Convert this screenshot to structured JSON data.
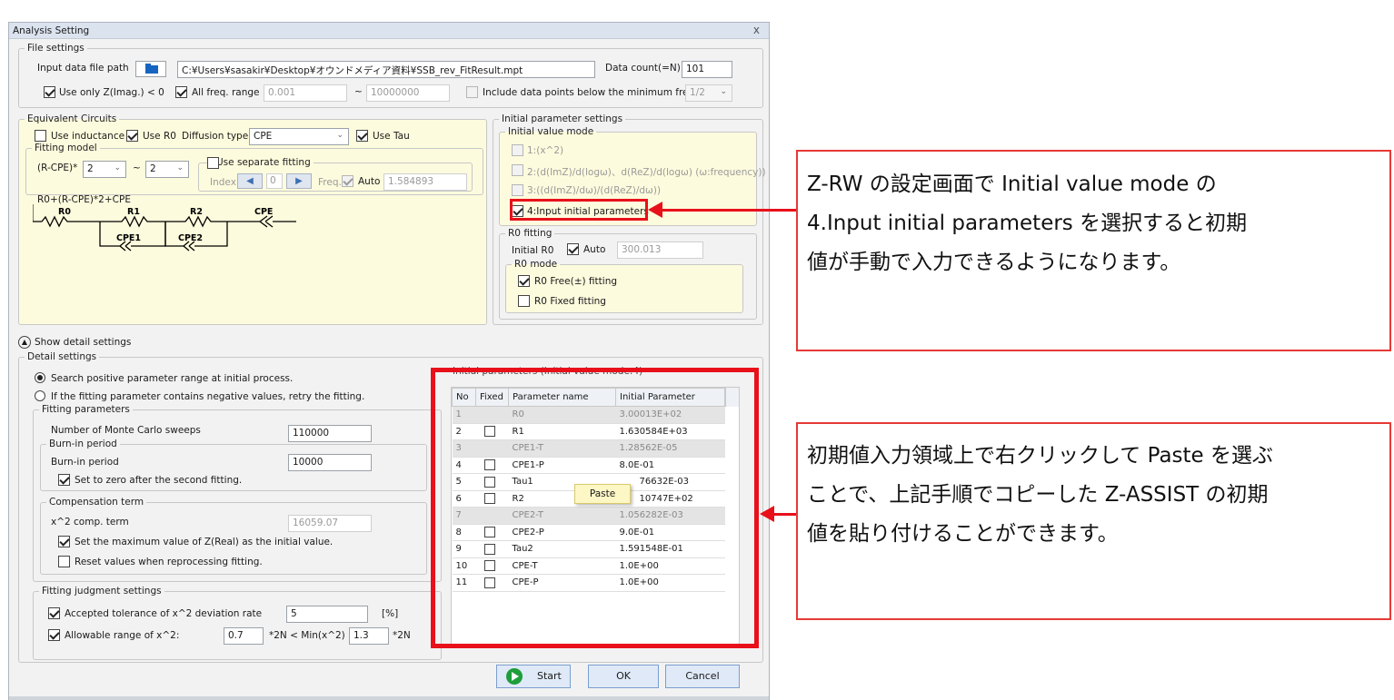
{
  "window": {
    "title": "Analysis Setting",
    "close": "x"
  },
  "file_settings": {
    "legend": "File settings",
    "input_path_label": "Input data file path",
    "input_path_value": "C:¥Users¥sasakir¥Desktop¥オウンドメディア資料¥SSB_rev_FitResult.mpt",
    "data_count_label": "Data count(=N)",
    "data_count_value": "101",
    "use_only_label": "Use only Z(Imag.) < 0",
    "all_freq_label": "All freq. range",
    "freq_min": "0.001",
    "tilde": "~",
    "freq_max": "10000000",
    "include_label": "Include data points below the minimum freq.",
    "ratio": "1/2"
  },
  "equivalent_circuits": {
    "legend": "Equivalent Circuits",
    "use_inductance": "Use inductance",
    "use_r0": "Use R0",
    "diffusion_label": "Diffusion type",
    "diffusion_value": "CPE",
    "use_tau": "Use Tau",
    "fitting_model_legend": "Fitting model",
    "rcpe_label": "(R-CPE)*",
    "rcpe_from": "2",
    "tilde": "~",
    "rcpe_to": "2",
    "separate_legend": "Use separate fitting",
    "index_label": "Index",
    "index_value": "0",
    "freq_label": "Freq.",
    "auto_label": "Auto",
    "freq_value": "1.584893",
    "formula": "R0+(R-CPE)*2+CPE",
    "circuit_labels": [
      "R0",
      "R1",
      "R2",
      "CPE",
      "CPE1",
      "CPE2"
    ]
  },
  "initial_parameter_settings": {
    "legend": "Initial parameter settings",
    "mode_legend": "Initial value mode",
    "modes": [
      "1:(x^2)",
      "2:(d(ImZ)/d(logω)、d(ReZ)/d(logω) (ω:frequency))",
      "3:((d(ImZ)/dω)/(d(ReZ)/dω))",
      "4:Input initial parameters"
    ],
    "r0_fitting_legend": "R0 fitting",
    "initial_r0_label": "Initial R0",
    "auto_label": "Auto",
    "initial_r0_value": "300.013",
    "r0_mode_legend": "R0 mode",
    "r0_free": "R0 Free(±) fitting",
    "r0_fixed": "R0 Fixed fitting"
  },
  "detail": {
    "toggle_label": "Show detail settings",
    "legend": "Detail settings",
    "radio1": "Search positive parameter range at initial process.",
    "radio2": "If the fitting parameter contains negative values, retry the fitting.",
    "fitting_params_legend": "Fitting parameters",
    "mc_label": "Number of Monte Carlo sweeps",
    "mc_value": "110000",
    "burnin_legend": "Burn-in period",
    "burnin_label": "Burn-in period",
    "burnin_value": "10000",
    "set_zero": "Set to zero after the second fitting.",
    "comp_legend": "Compensation term",
    "comp_label": "x^2 comp. term",
    "comp_value": "16059.07",
    "set_max": "Set the maximum value of Z(Real) as the initial value.",
    "reset_values": "Reset values when reprocessing fitting.",
    "judgment_legend": "Fitting judgment settings",
    "accepted_label": "Accepted tolerance of x^2 deviation rate",
    "accepted_value": "5",
    "accepted_unit": "[%]",
    "allowable_label": "Allowable range of x^2:",
    "allow_min": "0.7",
    "allow_mid": "*2N < Min(x^2) <",
    "allow_max": "1.3",
    "allow_unit": "*2N"
  },
  "grid": {
    "title": "Initial parameters (Initial value mode:4)",
    "headers": [
      "No",
      "Fixed",
      "Parameter name",
      "Initial Parameter"
    ],
    "rows": [
      {
        "no": "1",
        "name": "R0",
        "value": "3.00013E+02"
      },
      {
        "no": "2",
        "name": "R1",
        "value": "1.630584E+03"
      },
      {
        "no": "3",
        "name": "CPE1-T",
        "value": "1.28562E-05"
      },
      {
        "no": "4",
        "name": "CPE1-P",
        "value": "8.0E-01"
      },
      {
        "no": "5",
        "name": "Tau1",
        "value": "76632E-03"
      },
      {
        "no": "6",
        "name": "R2",
        "value": "10747E+02"
      },
      {
        "no": "7",
        "name": "CPE2-T",
        "value": "1.056282E-03"
      },
      {
        "no": "8",
        "name": "CPE2-P",
        "value": "9.0E-01"
      },
      {
        "no": "9",
        "name": "Tau2",
        "value": "1.591548E-01"
      },
      {
        "no": "10",
        "name": "CPE-T",
        "value": "1.0E+00"
      },
      {
        "no": "11",
        "name": "CPE-P",
        "value": "1.0E+00"
      }
    ],
    "context_menu": "Paste"
  },
  "buttons": {
    "start": "Start",
    "ok": "OK",
    "cancel": "Cancel"
  },
  "callouts": {
    "top": [
      "Z-RW の設定画面で Initial value mode の",
      "4.Input initial parameters を選択すると初期",
      "値が手動で入力できるようになります。"
    ],
    "bottom": [
      "初期値入力領域上で右クリックして Paste を選ぶ",
      "ことで、上記手順でコピーした Z-ASSIST の初期",
      "値を貼り付けることができます。"
    ]
  },
  "colors": {
    "highlight": "#e8101a",
    "panel_yellow": "#fdfbdd",
    "start_green": "#1e9e3a"
  }
}
